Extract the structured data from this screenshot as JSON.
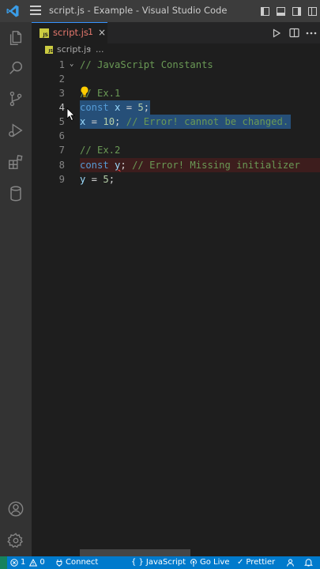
{
  "window": {
    "title": "script.js - Example - Visual Studio Code"
  },
  "tab": {
    "file_name": "script.js",
    "problems_badge": "1",
    "close_glyph": "×",
    "file_icon_text": "JS"
  },
  "breadcrumb": {
    "file": "script.js",
    "separator": "›",
    "more": "..."
  },
  "editor": {
    "active_line": 4,
    "lines": [
      {
        "number": "1",
        "text": "// JavaScript Constants"
      },
      {
        "number": "2",
        "text": ""
      },
      {
        "number": "3",
        "text": "// Ex.1"
      },
      {
        "number": "4",
        "text": "const x = 5;"
      },
      {
        "number": "5",
        "text": "x = 10; // Error! cannot be changed."
      },
      {
        "number": "6",
        "text": ""
      },
      {
        "number": "7",
        "text": "// Ex.2"
      },
      {
        "number": "8",
        "text": "const y; // Error! Missing initializer"
      },
      {
        "number": "9",
        "text": "y = 5;"
      }
    ]
  },
  "statusbar": {
    "errors": "1",
    "warnings": "0",
    "connect": "Connect",
    "language": "JavaScript",
    "go_live": "Go Live",
    "prettier": "Prettier",
    "braces": "{ }"
  },
  "colors": {
    "accent": "#007acc",
    "selection": "#264f78",
    "comment": "#6a9955",
    "keyword": "#569cd6",
    "variable": "#9cdcfe",
    "number": "#b5cea8",
    "error": "#f14c4c",
    "tab_modified": "#e5786d"
  },
  "icons": {
    "activity": [
      "explorer-icon",
      "search-icon",
      "source-control-icon",
      "run-debug-icon",
      "extensions-icon",
      "database-icon",
      "account-icon",
      "settings-gear-icon"
    ],
    "editor_actions": [
      "run-icon",
      "split-editor-icon",
      "more-actions-icon"
    ]
  }
}
